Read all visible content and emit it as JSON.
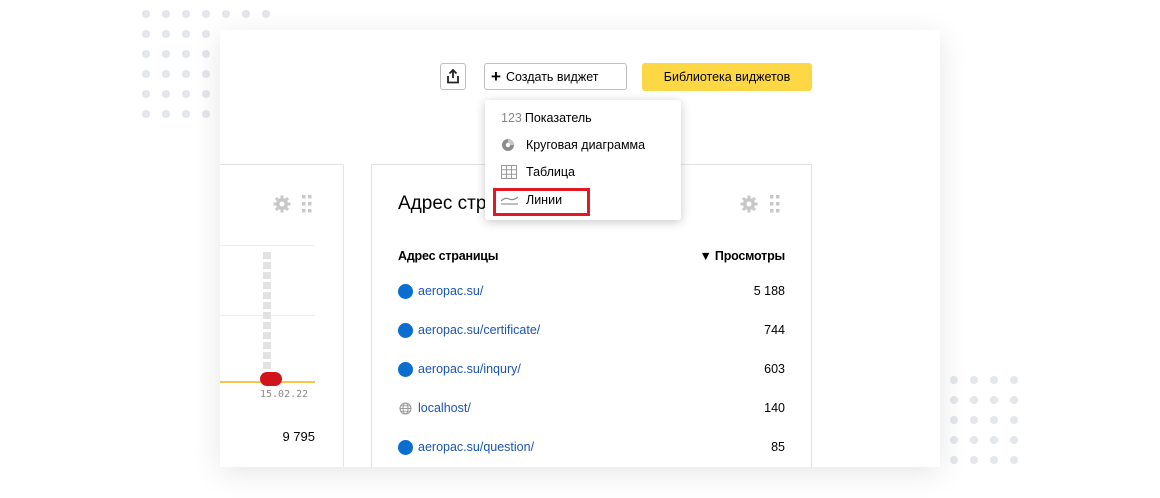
{
  "toolbar": {
    "create_label": "Создать виджет",
    "library_label": "Библиотека виджетов"
  },
  "menu": {
    "items": [
      {
        "prefix": "123",
        "label": "Показатель",
        "icon": "number-icon"
      },
      {
        "label": "Круговая диаграмма",
        "icon": "pie-chart-icon"
      },
      {
        "label": "Таблица",
        "icon": "table-icon"
      },
      {
        "label": "Линии",
        "icon": "line-chart-icon"
      }
    ]
  },
  "left_widget": {
    "date": "15.02.22",
    "total": "9 795"
  },
  "right_widget": {
    "title": "Адрес стр",
    "col_page": "Адрес страницы",
    "col_views": "▼ Просмотры",
    "rows": [
      {
        "url": "aeropac.su/",
        "views": "5 188"
      },
      {
        "url": "aeropac.su/certificate/",
        "views": "744"
      },
      {
        "url": "aeropac.su/inqury/",
        "views": "603"
      },
      {
        "url": "localhost/",
        "views": "140"
      },
      {
        "url": "aeropac.su/question/",
        "views": "85"
      }
    ]
  },
  "colors": {
    "accent_yellow": "#fed844",
    "link_blue": "#1a55b3",
    "favicon_blue": "#0a6ed1",
    "highlight_red": "#e01a22"
  }
}
